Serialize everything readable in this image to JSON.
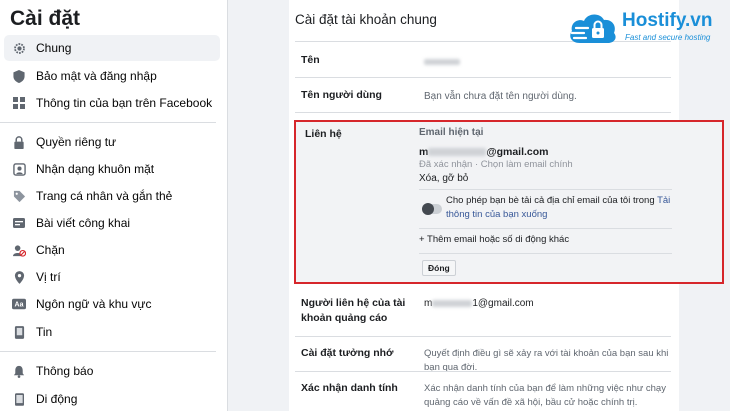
{
  "sidebar": {
    "title": "Cài đặt",
    "groups": [
      [
        {
          "label": "Chung",
          "icon": "gear-icon"
        },
        {
          "label": "Bảo mật và đăng nhập",
          "icon": "shield-icon"
        },
        {
          "label": "Thông tin của bạn trên Facebook",
          "icon": "grid-icon"
        }
      ],
      [
        {
          "label": "Quyền riêng tư",
          "icon": "lock-icon"
        },
        {
          "label": "Nhận dạng khuôn mặt",
          "icon": "face-icon"
        },
        {
          "label": "Trang cá nhân và gắn thẻ",
          "icon": "tag-icon"
        },
        {
          "label": "Bài viết công khai",
          "icon": "post-icon"
        },
        {
          "label": "Chặn",
          "icon": "block-icon"
        },
        {
          "label": "Vị trí",
          "icon": "location-icon"
        },
        {
          "label": "Ngôn ngữ và khu vực",
          "icon": "language-icon"
        },
        {
          "label": "Tin",
          "icon": "story-icon"
        }
      ],
      [
        {
          "label": "Thông báo",
          "icon": "bell-icon"
        },
        {
          "label": "Di động",
          "icon": "phone-icon"
        }
      ]
    ]
  },
  "main": {
    "title": "Cài đặt tài khoản chung",
    "name": {
      "label": "Tên"
    },
    "username": {
      "label": "Tên người dùng",
      "value": "Bạn vẫn chưa đặt tên người dùng."
    },
    "contact": {
      "label": "Liên hệ",
      "email_heading": "Email hiện tại",
      "email_suffix": "@gmail.com",
      "email_prefix_visible": "m",
      "status": "Đã xác nhận · Chọn làm email chính",
      "remove": "Xóa, gỡ bỏ",
      "toggle_text_a": "Cho phép bạn bè tải cả địa chỉ email của tôi trong ",
      "toggle_link": "Tải thông tin của bạn xuống",
      "add": "+ Thêm email hoặc số di động khác",
      "close": "Đóng"
    },
    "ad_contact": {
      "label": "Người liên hệ của tài khoản quảng cáo",
      "value_prefix": "m",
      "value_suffix": "1@gmail.com"
    },
    "memorial": {
      "label": "Cài đặt tưởng nhớ",
      "value": "Quyết định điều gì sẽ xảy ra với tài khoản của bạn sau khi bạn qua đời."
    },
    "identity": {
      "label": "Xác nhận danh tính",
      "value": "Xác nhận danh tính của bạn để làm những việc như chạy quảng cáo về vấn đề xã hội, bầu cử hoặc chính trị."
    }
  },
  "logo": {
    "name": "Hostify.vn",
    "tagline": "Fast and secure hosting"
  }
}
